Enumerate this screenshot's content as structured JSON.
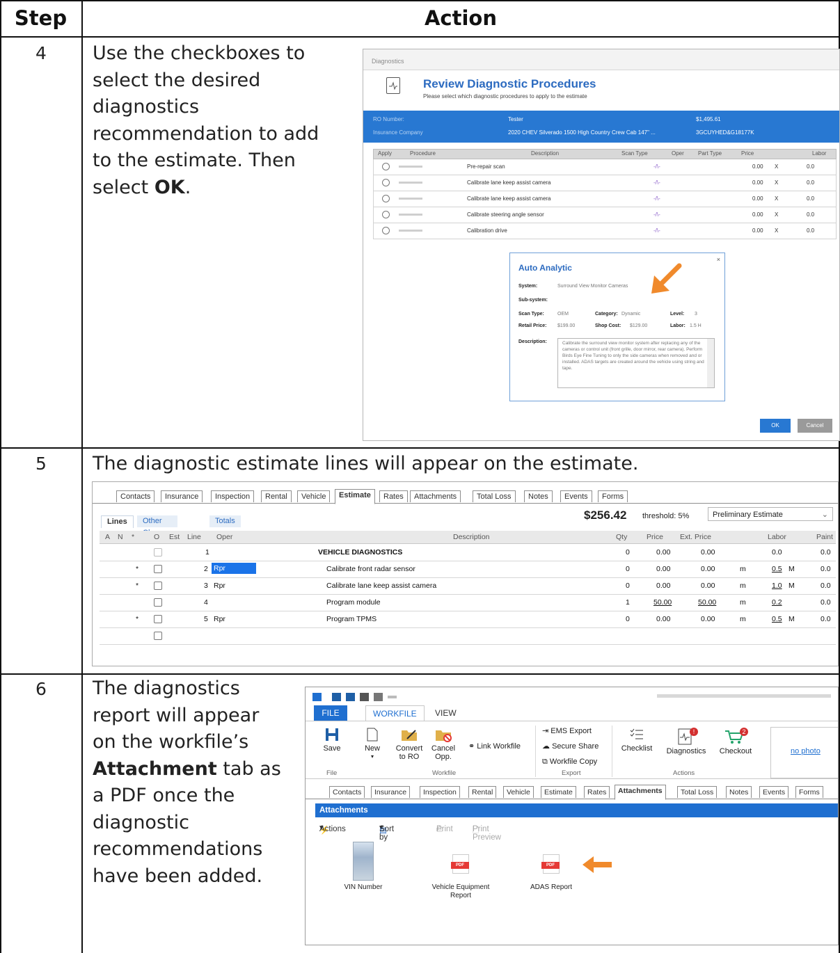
{
  "table": {
    "header_step": "Step",
    "header_action": "Action"
  },
  "steps": [
    {
      "number": "4",
      "text_before": "Use the checkboxes to select the desired diagnostics recommendation to add to the estimate. Then select ",
      "text_bold": "OK",
      "text_after": "."
    },
    {
      "number": "5",
      "text_before": "The diagnostic estimate lines will appear on the estimate.",
      "text_bold": "",
      "text_after": ""
    },
    {
      "number": "6",
      "text_before": "The diagnostics report will appear on the workfile’s ",
      "text_bold": "Attachment",
      "text_after": " tab as a PDF once the diagnostic recommendations have been added."
    }
  ],
  "diagnostics_dialog": {
    "window_title": "Diagnostics",
    "title": "Review Diagnostic Procedures",
    "subtitle": "Please select which diagnostic procedures to apply to the estimate",
    "info_bar": {
      "row1_label": "RO Number:",
      "row1_value": "Tester",
      "row1_amount": "$1,495.61",
      "row2_label": "Insurance Company",
      "row2_value": "2020 CHEV Silverado 1500 High Country Crew Cab 147\" ...",
      "row2_code": "3GCUYHED&G18177K"
    },
    "columns": [
      "Apply",
      "Procedure",
      "Description",
      "Scan Type",
      "Oper",
      "Part Type",
      "Price",
      "Labor"
    ],
    "rows": [
      {
        "description": "Pre-repair scan",
        "price": "0.00",
        "x": "X",
        "labor": "0.0"
      },
      {
        "description": "Calibrate lane keep assist camera",
        "price": "0.00",
        "x": "X",
        "labor": "0.0"
      },
      {
        "description": "Calibrate lane keep assist camera",
        "price": "0.00",
        "x": "X",
        "labor": "0.0"
      },
      {
        "description": "Calibrate steering angle sensor",
        "price": "0.00",
        "x": "X",
        "labor": "0.0"
      },
      {
        "description": "Calibration drive",
        "price": "0.00",
        "x": "X",
        "labor": "0.0"
      }
    ],
    "popup": {
      "title": "Auto Analytic",
      "close": "×",
      "system_label": "System:",
      "system_value": "Surround View Monitor Cameras",
      "subsystem_label": "Sub-system:",
      "scan_type_label": "Scan Type:",
      "scan_type_value": "OEM",
      "category_label": "Category:",
      "category_value": "Dynamic",
      "level_label": "Level:",
      "level_value": "3",
      "retail_label": "Retail Price:",
      "retail_value": "$199.00",
      "shop_cost_label": "Shop Cost:",
      "shop_cost_value": "$129.00",
      "labor_label": "Labor:",
      "labor_value": "1.5 H",
      "description_label": "Description:",
      "description_text": "Calibrate the surround view monitor system after replacing any of the cameras or control unit (front grille, door mirror, rear camera). Perform Birds Eye Fine Tuning to only the side cameras when removed and or installed. ADAS targets are created around the vehicle using string and tape."
    },
    "ok_label": "OK",
    "cancel_label": "Cancel"
  },
  "estimate": {
    "tabs": [
      "Contacts",
      "Insurance",
      "Inspection",
      "Rental",
      "Vehicle",
      "Estimate",
      "Rates",
      "Attachments",
      "Total Loss",
      "Notes",
      "Events",
      "Forms"
    ],
    "active_tab": "Estimate",
    "subtabs": [
      "Lines",
      "Other Charges",
      "Totals"
    ],
    "total": "$256.42",
    "threshold": "threshold: 5%",
    "estimate_type": "Preliminary Estimate",
    "columns": [
      "A",
      "N",
      "*",
      "O",
      "Est",
      "Line",
      "Oper",
      "Description",
      "Qty",
      "Price",
      "Ext. Price",
      "Labor",
      "Paint"
    ],
    "rows": [
      {
        "star": "",
        "line": "1",
        "oper": "",
        "description": "VEHICLE DIAGNOSTICS",
        "qty": "0",
        "price": "0.00",
        "ext": "0.00",
        "m": "",
        "labor": "0.0",
        "lm": "",
        "paint": "0.0"
      },
      {
        "star": "*",
        "line": "2",
        "oper": "Rpr",
        "description": "Calibrate front radar sensor",
        "qty": "0",
        "price": "0.00",
        "ext": "0.00",
        "m": "m",
        "labor": "0.5",
        "lm": "M",
        "paint": "0.0"
      },
      {
        "star": "*",
        "line": "3",
        "oper": "Rpr",
        "description": "Calibrate lane keep assist camera",
        "qty": "0",
        "price": "0.00",
        "ext": "0.00",
        "m": "m",
        "labor": "1.0",
        "lm": "M",
        "paint": "0.0"
      },
      {
        "star": "",
        "line": "4",
        "oper": "",
        "description": "Program module",
        "qty": "1",
        "price": "50.00",
        "ext": "50.00",
        "m": "m",
        "labor": "0.2",
        "lm": "",
        "paint": "0.0"
      },
      {
        "star": "*",
        "line": "5",
        "oper": "Rpr",
        "description": "Program TPMS",
        "qty": "0",
        "price": "0.00",
        "ext": "0.00",
        "m": "m",
        "labor": "0.5",
        "lm": "M",
        "paint": "0.0"
      }
    ]
  },
  "workfile": {
    "ribbon_tabs": [
      "FILE",
      "WORKFILE",
      "VIEW"
    ],
    "active_ribbon_tab": "WORKFILE",
    "buttons": {
      "save": "Save",
      "new": "New",
      "convert": "Convert to RO",
      "cancel": "Cancel Opp.",
      "link": "Link Workfile",
      "ems": "EMS Export",
      "secure": "Secure Share",
      "copy": "Workfile Copy",
      "checklist": "Checklist",
      "diagnostics": "Diagnostics",
      "checkout": "Checkout",
      "no_photo": "no photo"
    },
    "badges": {
      "diagnostics": "!",
      "checkout": "2"
    },
    "groups": {
      "file": "File",
      "workfile": "Workfile",
      "export": "Export",
      "actions": "Actions"
    },
    "tabs": [
      "Contacts",
      "Insurance",
      "Inspection",
      "Rental",
      "Vehicle",
      "Estimate",
      "Rates",
      "Attachments",
      "Total Loss",
      "Notes",
      "Events",
      "Forms"
    ],
    "active_tab": "Attachments",
    "section_title": "Attachments",
    "toolbar": {
      "actions": "Actions",
      "sort": "Sort by",
      "print": "Print",
      "preview": "Print Preview"
    },
    "attachments": [
      {
        "name": "VIN Number",
        "type": "image"
      },
      {
        "name": "Vehicle Equipment Report",
        "type": "pdf"
      },
      {
        "name": "ADAS Report",
        "type": "pdf"
      }
    ],
    "pdf_label": "PDF"
  },
  "colors": {
    "accent_blue": "#1f6fd0",
    "arrow_orange": "#f08a2c",
    "badge_red": "#d32f2f",
    "checkout_green": "#22a36a"
  }
}
